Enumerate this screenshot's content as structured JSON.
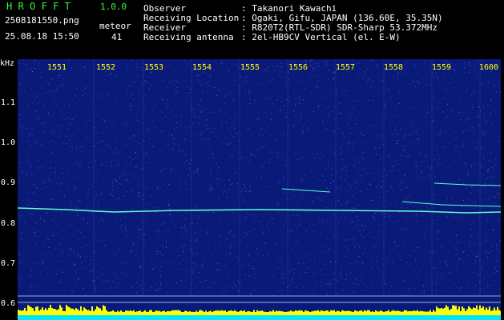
{
  "header": {
    "app_name": "HROFFT",
    "version": "1.0.0",
    "filename": "2508181550.png",
    "datetime": "25.08.18 15:50",
    "meteor_label": "meteor",
    "meteor_count": "41",
    "info": [
      {
        "key": "Observer",
        "value": ": Takanori Kawachi"
      },
      {
        "key": "Receiving Location",
        "value": ": Ogaki, Gifu, JAPAN (136.60E, 35.35N)"
      },
      {
        "key": "Receiver",
        "value": ": R820T2(RTL-SDR) SDR-Sharp 53.372MHz"
      },
      {
        "key": "Receiving antenna",
        "value": ": 2el-HB9CV Vertical (el. E-W)"
      }
    ]
  },
  "spectrogram": {
    "freq_unit": "kHz",
    "y_ticks": [
      "1.1",
      "1.0",
      "0.9",
      "0.8",
      "0.7",
      "0.6"
    ],
    "x_ticks": [
      "1551",
      "1552",
      "1553",
      "1554",
      "1555",
      "1556",
      "1557",
      "1558",
      "1559",
      "1600"
    ],
    "colors": {
      "background": "#0a1a78",
      "noise": "#4a6cff",
      "signal": "#5cffd0",
      "baseline": "#ffff00",
      "baseline_top": "#00e5ff"
    }
  }
}
